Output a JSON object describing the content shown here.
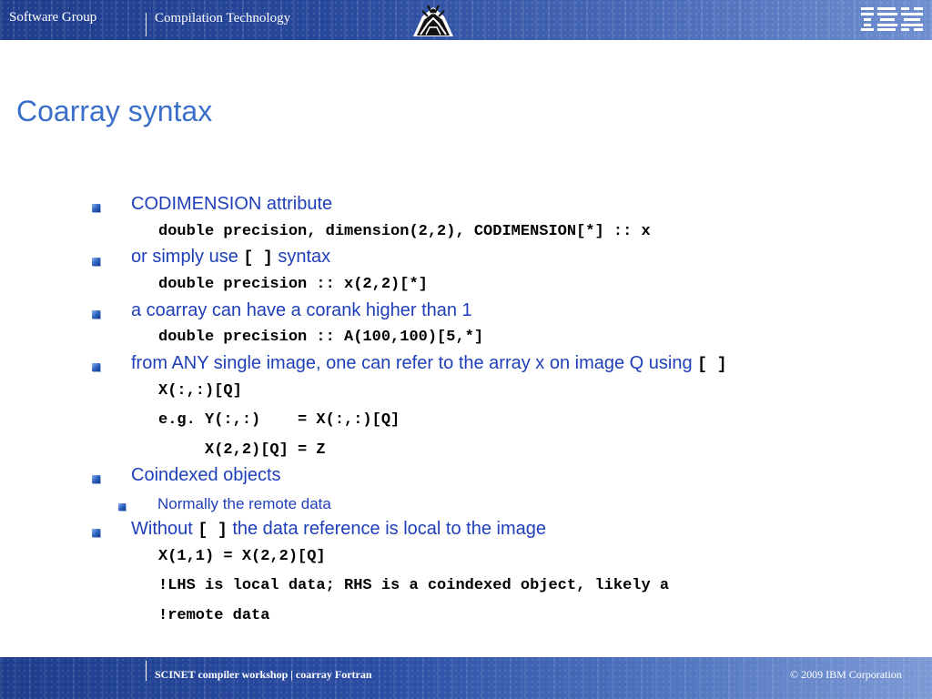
{
  "header": {
    "left_text": "Software Group",
    "center_text": "Compilation Technology",
    "logo": "ibm-logo",
    "emblem": "compiler-emblem-icon"
  },
  "slide": {
    "title": "Coarray syntax",
    "items": [
      {
        "type": "bullet1",
        "text": "CODIMENSION attribute"
      },
      {
        "type": "code",
        "text": "double precision, dimension(2,2), CODIMENSION[*] :: x"
      },
      {
        "type": "bullet1",
        "text": "or simply use ",
        "code": "[ ]",
        "after": " syntax"
      },
      {
        "type": "code",
        "text": "double precision :: x(2,2)[*]"
      },
      {
        "type": "bullet1",
        "text": "a coarray can have a corank higher than 1"
      },
      {
        "type": "code",
        "text": "double precision :: A(100,100)[5,*]"
      },
      {
        "type": "bullet1",
        "text": "from ANY single image, one can refer to the array x on image Q using ",
        "code": "[ ]"
      },
      {
        "type": "code",
        "text": "X(:,:)[Q]"
      },
      {
        "type": "code",
        "text": "e.g. Y(:,:)    = X(:,:)[Q]"
      },
      {
        "type": "code",
        "text": "     X(2,2)[Q] = Z"
      },
      {
        "type": "bullet1",
        "text": "Coindexed objects"
      },
      {
        "type": "bullet2",
        "text": "Normally the remote data"
      },
      {
        "type": "bullet1",
        "text": "Without ",
        "code": "[ ]",
        "after": " the data reference is local to the image"
      },
      {
        "type": "code",
        "text": "X(1,1) = X(2,2)[Q]"
      },
      {
        "type": "code",
        "text": "!LHS is local data; RHS is a coindexed object, likely a"
      },
      {
        "type": "code",
        "text": "!remote data"
      }
    ]
  },
  "footer": {
    "workshop": "SCINET compiler workshop",
    "topic": "coarray Fortran",
    "copyright": "© 2009 IBM Corporation"
  },
  "colors": {
    "title": "#3a6fc9",
    "bullet_text": "#1f3fb8",
    "bar": "#27479b"
  }
}
